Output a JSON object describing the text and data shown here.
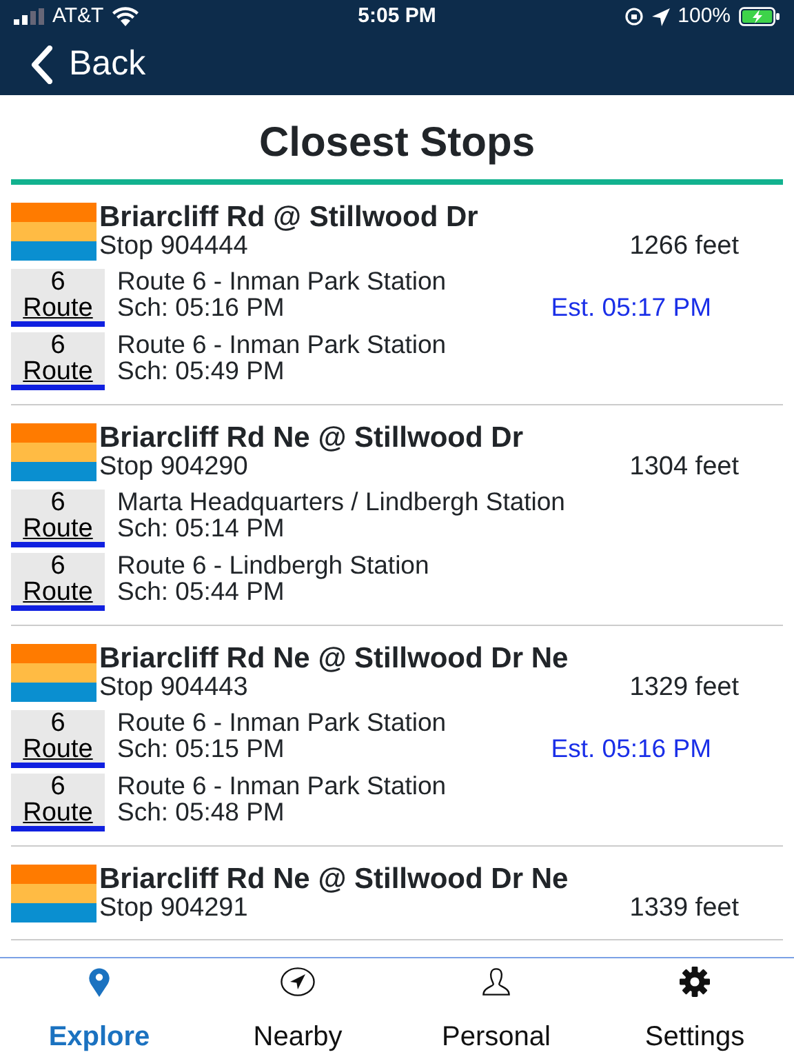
{
  "status_bar": {
    "carrier": "AT&T",
    "time": "5:05 PM",
    "battery": "100%"
  },
  "nav": {
    "back": "Back"
  },
  "title": "Closest Stops",
  "stops": [
    {
      "name": "Briarcliff Rd @ Stillwood Dr",
      "stop": "Stop 904444",
      "distance": "1266 feet",
      "arrivals": [
        {
          "route_number": "6",
          "route_label": "Route",
          "destination": "Route 6 - Inman Park Station",
          "scheduled": "Sch: 05:16 PM",
          "estimated": "Est. 05:17 PM"
        },
        {
          "route_number": "6",
          "route_label": "Route",
          "destination": "Route 6 - Inman Park Station",
          "scheduled": "Sch: 05:49 PM"
        }
      ]
    },
    {
      "name": "Briarcliff Rd Ne @ Stillwood Dr",
      "stop": "Stop 904290",
      "distance": "1304 feet",
      "arrivals": [
        {
          "route_number": "6",
          "route_label": "Route",
          "destination": "Marta Headquarters / Lindbergh Station",
          "scheduled": "Sch: 05:14 PM"
        },
        {
          "route_number": "6",
          "route_label": "Route",
          "destination": "Route 6 - Lindbergh Station",
          "scheduled": "Sch: 05:44 PM"
        }
      ]
    },
    {
      "name": "Briarcliff Rd Ne @ Stillwood Dr Ne",
      "stop": "Stop 904443",
      "distance": "1329 feet",
      "arrivals": [
        {
          "route_number": "6",
          "route_label": "Route",
          "destination": "Route 6 - Inman Park Station",
          "scheduled": "Sch: 05:15 PM",
          "estimated": "Est. 05:16 PM"
        },
        {
          "route_number": "6",
          "route_label": "Route",
          "destination": "Route 6 - Inman Park Station",
          "scheduled": "Sch: 05:48 PM"
        }
      ]
    },
    {
      "name": "Briarcliff Rd Ne @ Stillwood Dr Ne",
      "stop": "Stop 904291",
      "distance": "1339 feet"
    }
  ],
  "tab_bar": [
    {
      "kind": "explore",
      "label": "Explore",
      "selected": true
    },
    {
      "kind": "nearby",
      "label": "Nearby",
      "selected": false
    },
    {
      "kind": "personal",
      "label": "Personal",
      "selected": false
    },
    {
      "kind": "settings",
      "label": "Settings",
      "selected": false
    }
  ]
}
